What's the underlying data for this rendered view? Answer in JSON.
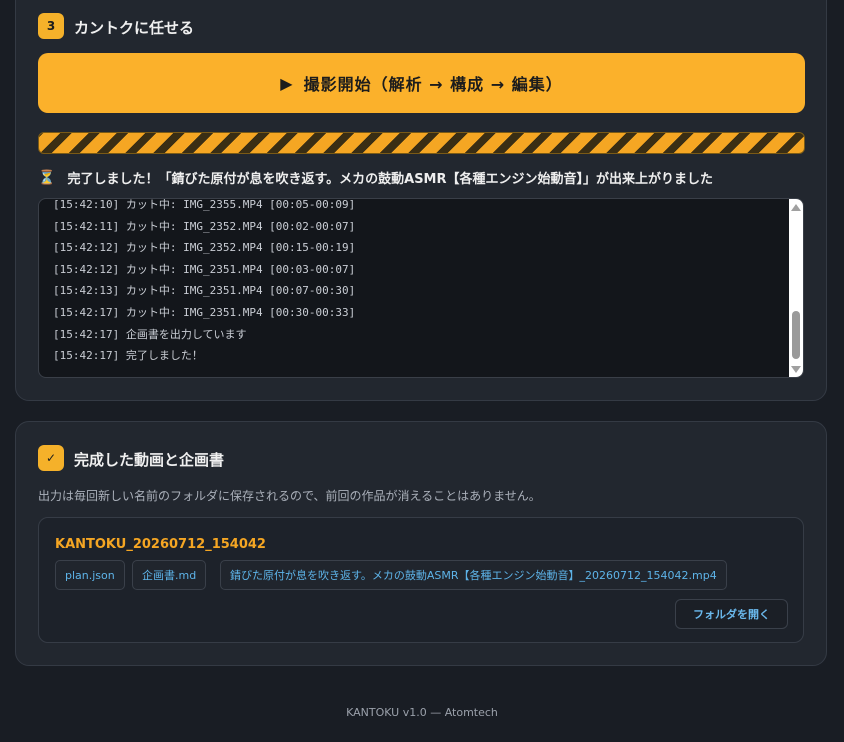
{
  "step3": {
    "badge": "3",
    "title": "カントクに任せる",
    "start_button": {
      "icon": "play-icon",
      "icon_glyph": "▶",
      "label": "撮影開始（解析 → 構成 → 編集）"
    },
    "progress": {
      "value": 1.0,
      "style": "striped-animated",
      "color": "#f5a623"
    },
    "status": {
      "icon": "hourglass-icon",
      "icon_glyph": "⏳",
      "text": "完了しました！「錆びた原付が息を吹き返す。メカの鼓動ASMR【各種エンジン始動音】」が出来上がりました"
    },
    "log": [
      "[15:42:10] カット中: IMG_2355.MP4 [00:05-00:09]",
      "[15:42:11] カット中: IMG_2352.MP4 [00:02-00:07]",
      "[15:42:12] カット中: IMG_2352.MP4 [00:15-00:19]",
      "[15:42:12] カット中: IMG_2351.MP4 [00:03-00:07]",
      "[15:42:13] カット中: IMG_2351.MP4 [00:07-00:30]",
      "[15:42:17] カット中: IMG_2351.MP4 [00:30-00:33]",
      "[15:42:17] 企画書を出力しています",
      "[15:42:17] 完了しました！"
    ]
  },
  "result": {
    "badge": "✓",
    "title": "完成した動画と企画書",
    "description": "出力は毎回新しい名前のフォルダに保存されるので、前回の作品が消えることはありません。",
    "folder_name": "KANTOKU_20260712_154042",
    "files": [
      "plan.json",
      "企画書.md",
      "錆びた原付が息を吹き返す。メカの鼓動ASMR【各種エンジン始動音】_20260712_154042.mp4"
    ],
    "open_folder_label": "フォルダを開く"
  },
  "footer": "KANTOKU v1.0 — Atomtech",
  "colors": {
    "accent": "#fbb12b",
    "link": "#5db3e8",
    "background": "#191d24",
    "card": "#22272f"
  }
}
